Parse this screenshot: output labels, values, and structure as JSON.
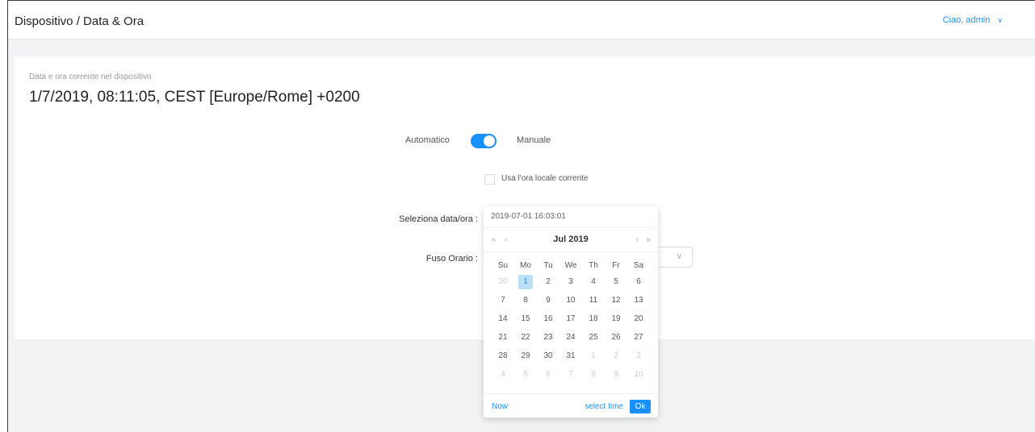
{
  "header": {
    "title": "Dispositivo / Data & Ora",
    "user_menu": "Ciao, admin"
  },
  "current": {
    "label": "Data e ora corrente nel dispositivo",
    "value": "1/7/2019, 08:11:05, CEST [Europe/Rome] +0200"
  },
  "mode": {
    "automatic_label": "Automatico",
    "manual_label": "Manuale",
    "toggle_on": true
  },
  "use_local": {
    "label": "Usa l'ora locale corrente",
    "checked": false
  },
  "form": {
    "select_label": "Seleziona data/ora :",
    "timezone_label": "Fuso Orario :"
  },
  "picker": {
    "input_value": "2019-07-01 16:03:01",
    "nav_prev_year": "«",
    "nav_prev_month": "‹",
    "nav_next_month": "›",
    "nav_next_year": "»",
    "month_title": "Jul 2019",
    "weekdays": [
      "Su",
      "Mo",
      "Tu",
      "We",
      "Th",
      "Fr",
      "Sa"
    ],
    "weeks": [
      [
        "30",
        "1",
        "2",
        "3",
        "4",
        "5",
        "6"
      ],
      [
        "7",
        "8",
        "9",
        "10",
        "11",
        "12",
        "13"
      ],
      [
        "14",
        "15",
        "16",
        "17",
        "18",
        "19",
        "20"
      ],
      [
        "21",
        "22",
        "23",
        "24",
        "25",
        "26",
        "27"
      ],
      [
        "28",
        "29",
        "30",
        "31",
        "1",
        "2",
        "3"
      ],
      [
        "4",
        "5",
        "6",
        "7",
        "8",
        "9",
        "10"
      ]
    ],
    "selected_day": "1",
    "now_label": "Now",
    "select_time_label": "select time",
    "ok_label": "Ok"
  },
  "colors": {
    "accent": "#1890ff",
    "selected_bg": "#bae0f5",
    "page_bg": "#f0f2f5"
  }
}
